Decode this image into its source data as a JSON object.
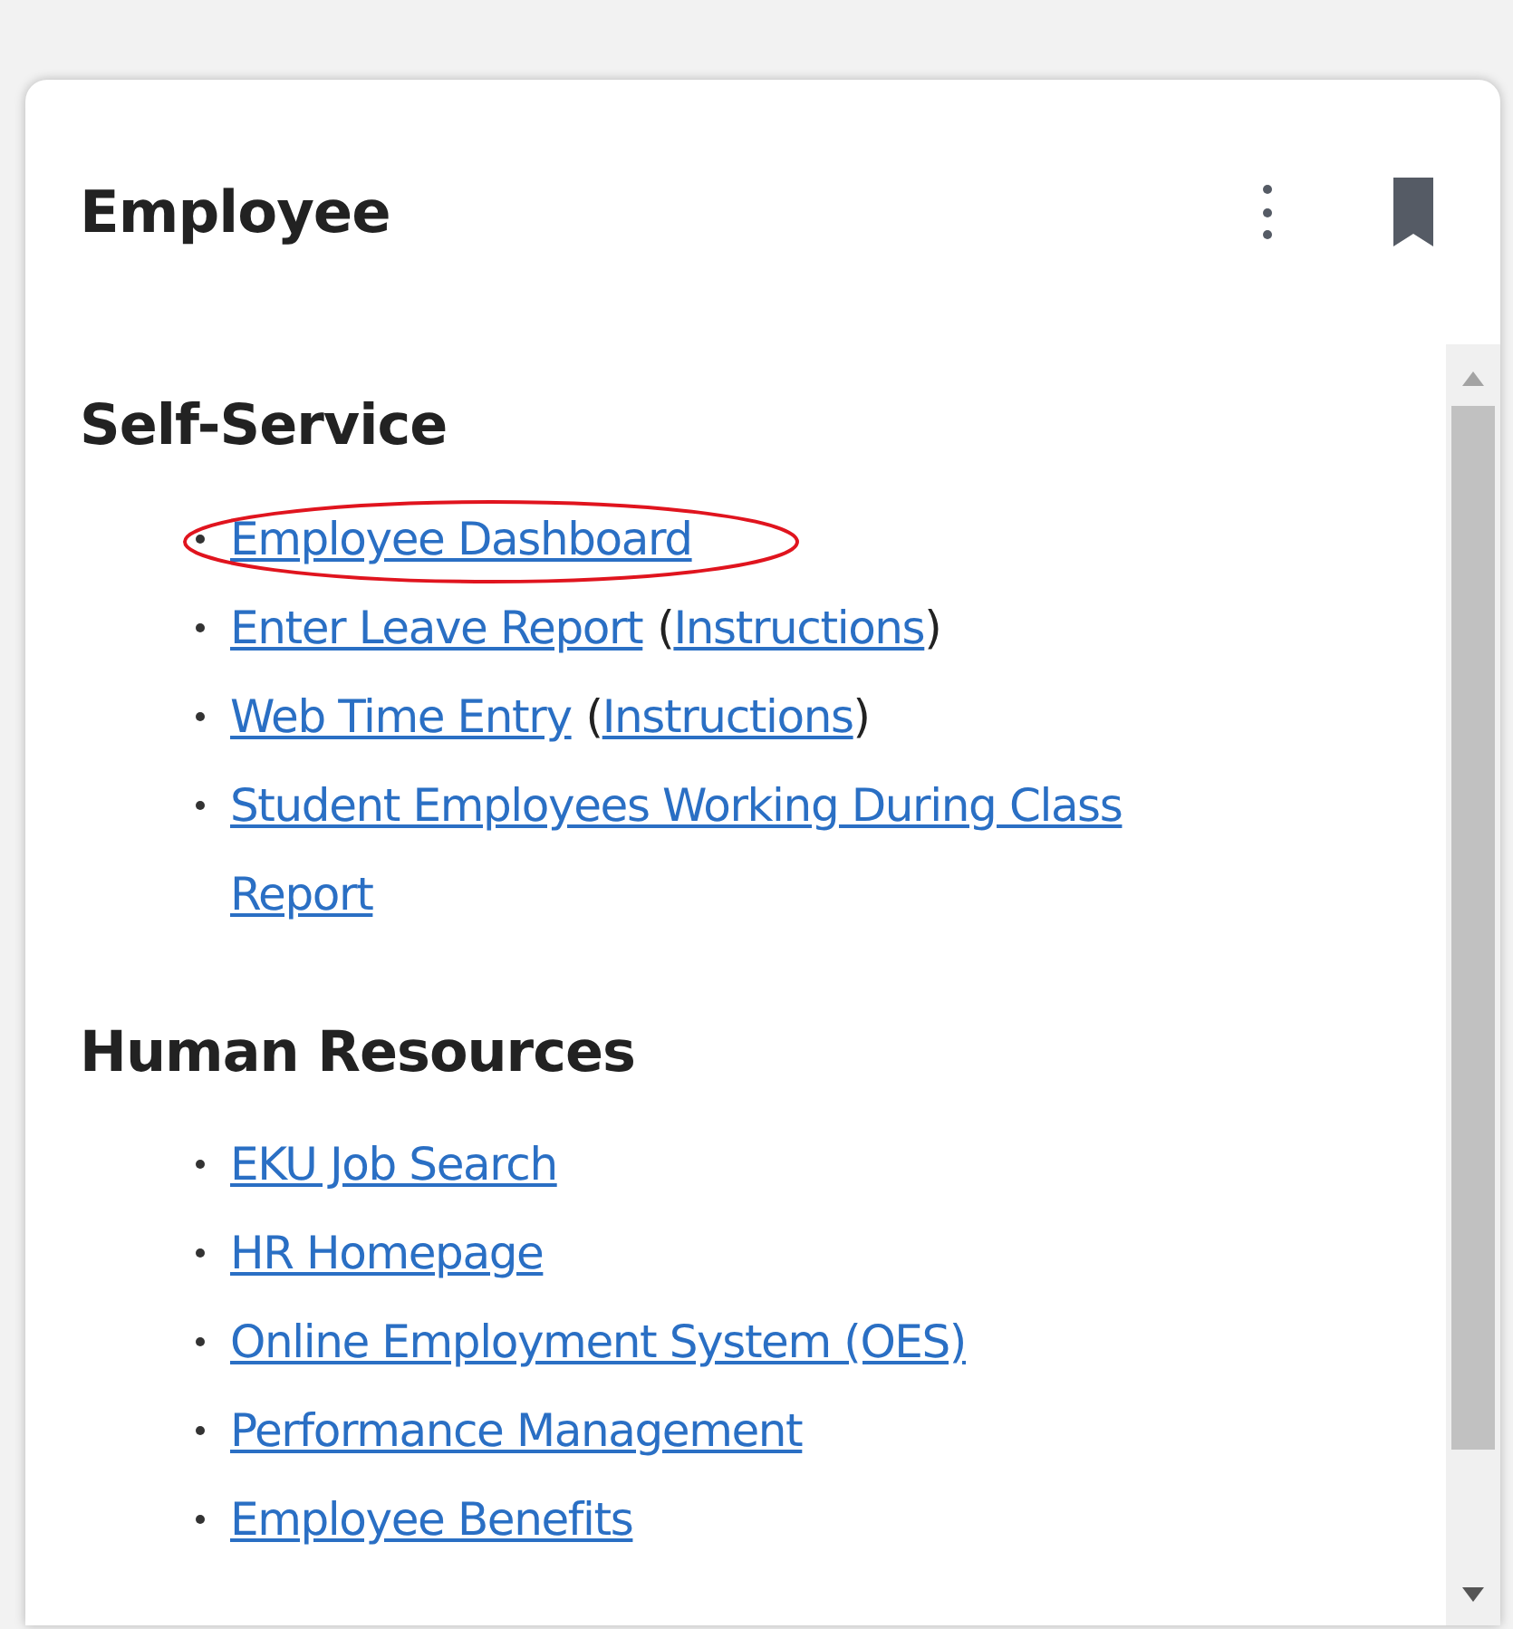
{
  "card": {
    "title": "Employee"
  },
  "sections": [
    {
      "heading": "Self-Service",
      "items": [
        {
          "label": "Employee Dashboard",
          "highlighted": true
        },
        {
          "label": "Enter Leave Report",
          "note": {
            "open": "(",
            "label": "Instructions",
            "close": ")"
          },
          "highlighted": false
        },
        {
          "label": "Web Time Entry",
          "note": {
            "open": "(",
            "label": "Instructions",
            "close": ")"
          },
          "highlighted": false
        },
        {
          "label": "Student Employees Working During Class Report",
          "highlighted": false
        }
      ]
    },
    {
      "heading": "Human Resources",
      "items": [
        {
          "label": "EKU Job Search",
          "highlighted": false
        },
        {
          "label": "HR Homepage",
          "highlighted": false
        },
        {
          "label": "Online Employment System (OES)",
          "highlighted": false
        },
        {
          "label": "Performance Management",
          "highlighted": false
        },
        {
          "label": "Employee Benefits",
          "highlighted": false
        }
      ]
    }
  ]
}
